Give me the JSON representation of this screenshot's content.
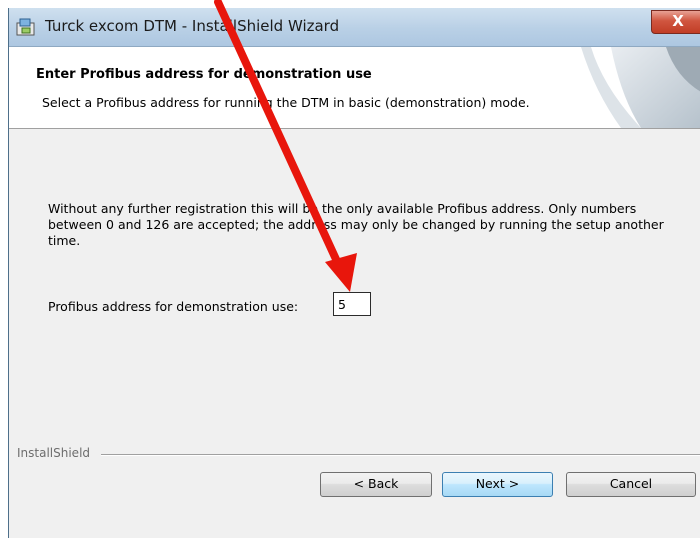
{
  "window": {
    "title": "Turck excom DTM - InstallShield Wizard",
    "close_glyph": "X"
  },
  "banner": {
    "title": "Enter Profibus address for demonstration use",
    "subtitle": "Select a Profibus address for running the DTM in basic (demonstration) mode."
  },
  "body": {
    "description": "Without any further registration this will be the only available Profibus address. Only numbers between 0 and 126 are accepted; the address may only be changed by running the setup another time.",
    "address_label": "Profibus address for demonstration use:",
    "address_value": "5"
  },
  "footer": {
    "brand": "InstallShield",
    "back_label": "< Back",
    "next_label": "Next >",
    "cancel_label": "Cancel"
  },
  "annotation": {
    "color": "#e8160c"
  }
}
